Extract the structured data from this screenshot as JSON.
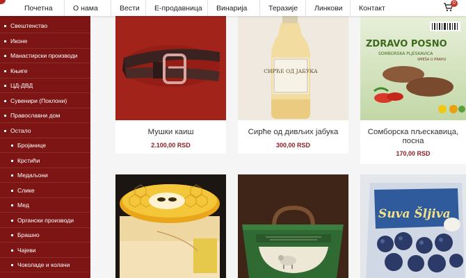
{
  "nav": {
    "items": [
      "Почетна",
      "О нама",
      "Вести",
      "Е-продавница",
      "Винарија",
      "Теразије",
      "Линкови",
      "Контакт"
    ],
    "cart_count": "0"
  },
  "sidebar": {
    "items": [
      {
        "label": "Свештенство",
        "level": 0
      },
      {
        "label": "Иконе",
        "level": 0
      },
      {
        "label": "Манастирски производи",
        "level": 0
      },
      {
        "label": "Књиге",
        "level": 0
      },
      {
        "label": "ЦД-ДВД",
        "level": 0
      },
      {
        "label": "Сувенири (Поклони)",
        "level": 0
      },
      {
        "label": "Православни дом",
        "level": 0
      },
      {
        "label": "Остало",
        "level": 0
      },
      {
        "label": "Бројанице",
        "level": 1
      },
      {
        "label": "Крстићи",
        "level": 1
      },
      {
        "label": "Медаљони",
        "level": 1
      },
      {
        "label": "Слике",
        "level": 1
      },
      {
        "label": "Мед",
        "level": 1
      },
      {
        "label": "Органски производи",
        "level": 1
      },
      {
        "label": "Брашно",
        "level": 1
      },
      {
        "label": "Чајеви",
        "level": 1
      },
      {
        "label": "Чоколаде и колачи",
        "level": 1
      }
    ]
  },
  "products": [
    {
      "name": "Мушки каиш",
      "price": "2.100,00 RSD",
      "image": "belt-photo"
    },
    {
      "name": "Сирће од дивљих јабука",
      "price": "300,00 RSD",
      "image": "vinegar-bottle-photo"
    },
    {
      "name": "Сомборска пљескавица, посна",
      "price": "170,00 RSD",
      "image": "patty-package-photo"
    },
    {
      "name": "",
      "price": "",
      "image": "honey-jar-photo"
    },
    {
      "name": "",
      "price": "",
      "image": "gift-box-photo"
    },
    {
      "name": "",
      "price": "",
      "image": "dried-plums-photo"
    }
  ],
  "packaging": {
    "vinegar_label": "СИРЋЕ ОД ЈАБУКА",
    "patty_brand": "ZDRAVO POSNO",
    "patty_sub": "SOMBORSKA PLJESKAVICA",
    "patty_note": "SMEŠA U PRAHU",
    "plums_label": "Suva Šljiva"
  },
  "colors": {
    "sidebar_bg": "#7d1515",
    "price": "#8a1d1d",
    "badge": "#c0392b"
  }
}
